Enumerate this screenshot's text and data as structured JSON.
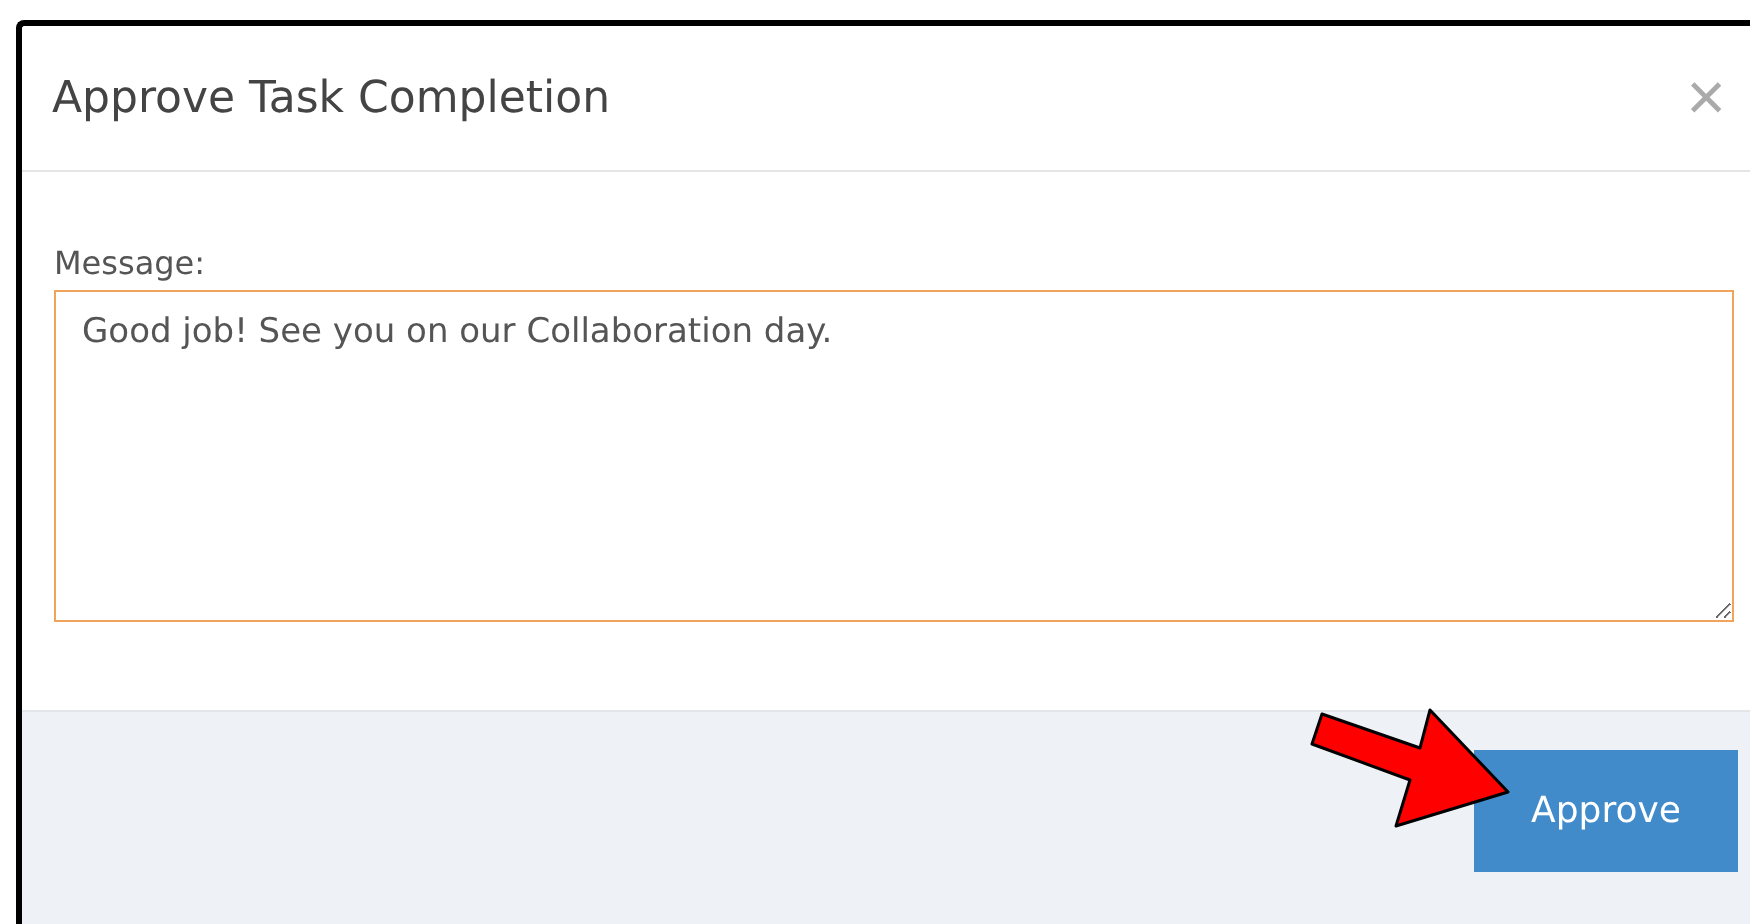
{
  "dialog": {
    "title": "Approve Task Completion",
    "close": "×",
    "message_label": "Message:",
    "message_value": "Good job! See you on our Collaboration day.",
    "buttons": [
      {
        "label": "Approve",
        "kind": "primary"
      }
    ]
  }
}
